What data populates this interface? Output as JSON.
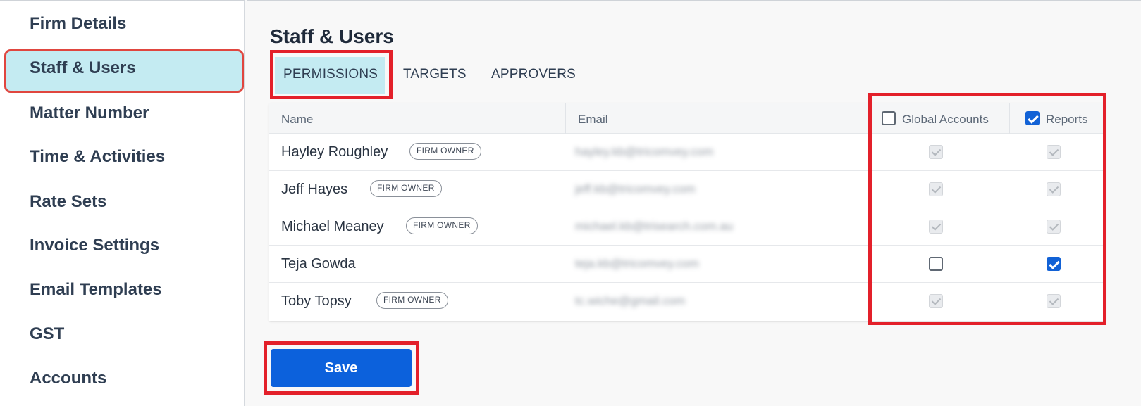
{
  "sidebar": {
    "items": [
      {
        "label": "Firm Details"
      },
      {
        "label": "Staff & Users"
      },
      {
        "label": "Matter Number"
      },
      {
        "label": "Time & Activities"
      },
      {
        "label": "Rate Sets"
      },
      {
        "label": "Invoice Settings"
      },
      {
        "label": "Email Templates"
      },
      {
        "label": "GST"
      },
      {
        "label": "Accounts"
      }
    ],
    "active_index": 1
  },
  "main": {
    "title": "Staff & Users",
    "tabs": [
      {
        "label": "PERMISSIONS",
        "active": true
      },
      {
        "label": "TARGETS",
        "active": false
      },
      {
        "label": "APPROVERS",
        "active": false
      }
    ],
    "table": {
      "columns": {
        "name": "Name",
        "email": "Email",
        "global_accounts": "Global Accounts",
        "reports": "Reports"
      },
      "header_checks": {
        "global_accounts": false,
        "reports": true
      },
      "rows": [
        {
          "name": "Hayley Roughley",
          "badge": "FIRM OWNER",
          "email": "hayley.kb@tricomvey.com",
          "global_accounts": "disabled-checked",
          "reports": "disabled-checked"
        },
        {
          "name": "Jeff Hayes",
          "badge": "FIRM OWNER",
          "email": "jeff.kb@tricomvey.com",
          "global_accounts": "disabled-checked",
          "reports": "disabled-checked"
        },
        {
          "name": "Michael Meaney",
          "badge": "FIRM OWNER",
          "email": "michael.kb@trisearch.com.au",
          "global_accounts": "disabled-checked",
          "reports": "disabled-checked"
        },
        {
          "name": "Teja Gowda",
          "badge": "",
          "email": "teja.kb@tricomvey.com",
          "global_accounts": "unchecked",
          "reports": "checked"
        },
        {
          "name": "Toby Topsy",
          "badge": "FIRM OWNER",
          "email": "tc.wiche@gmail.com",
          "global_accounts": "disabled-checked",
          "reports": "disabled-checked"
        }
      ]
    },
    "save_label": "Save"
  },
  "colors": {
    "accent": "#0c61dc",
    "active_bg": "#c4ebf2",
    "highlight_box": "#e3202a"
  }
}
